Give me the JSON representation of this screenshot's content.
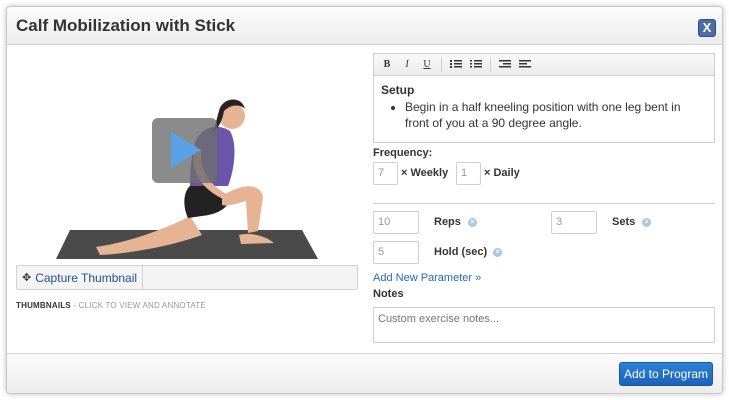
{
  "dialog": {
    "title": "Calf Mobilization with Stick",
    "close_label": "X"
  },
  "media": {
    "play_icon": "play-icon",
    "capture_label": "Capture Thumbnail",
    "capture_icon": "move-icon"
  },
  "thumbnails": {
    "heading": "THUMBNAILS",
    "hint": " - CLICK TO VIEW AND ANNOTATE"
  },
  "editor": {
    "toolbar": {
      "bold": "B",
      "italic": "I",
      "underline": "U",
      "bullet_icon": "bullet-list-icon",
      "number_icon": "numbered-list-icon",
      "indent_icon": "indent-icon",
      "outdent_icon": "outdent-icon"
    },
    "section_title": "Setup",
    "bullet": "Begin in a half kneeling position with one leg bent in front of you at a 90 degree angle."
  },
  "frequency": {
    "label": "Frequency:",
    "weekly": {
      "value": "7",
      "label": "× Weekly"
    },
    "daily": {
      "value": "1",
      "label": "× Daily"
    }
  },
  "params": {
    "reps": {
      "value": "10",
      "label": "Reps"
    },
    "sets": {
      "value": "3",
      "label": "Sets"
    },
    "hold": {
      "value": "5",
      "label": "Hold (sec)"
    },
    "remove_icon": "remove-icon",
    "add_link": "Add New Parameter »"
  },
  "notes": {
    "label": "Notes",
    "placeholder": "Custom exercise notes..."
  },
  "footer": {
    "add_button": "Add to Program"
  },
  "colors": {
    "accent": "#2b74c8",
    "link": "#2a66c2",
    "remove": "#a6c9e8",
    "mat": "#4a4a4a",
    "top": "#6a55a8",
    "skin": "#e6b394"
  }
}
